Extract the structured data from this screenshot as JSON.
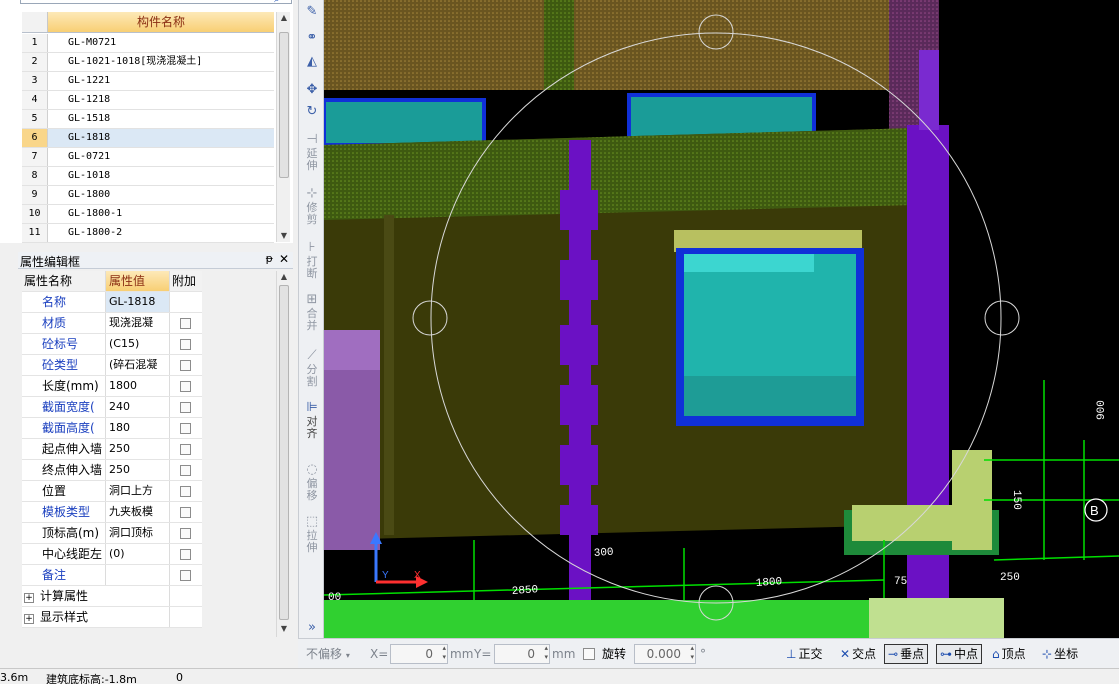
{
  "component_list": {
    "header": "构件名称",
    "rows": [
      {
        "num": "1",
        "name": "GL-M0721"
      },
      {
        "num": "2",
        "name": "GL-1021-1018[现浇混凝土]"
      },
      {
        "num": "3",
        "name": "GL-1221"
      },
      {
        "num": "4",
        "name": "GL-1218"
      },
      {
        "num": "5",
        "name": "GL-1518"
      },
      {
        "num": "6",
        "name": "GL-1818"
      },
      {
        "num": "7",
        "name": "GL-0721"
      },
      {
        "num": "8",
        "name": "GL-1018"
      },
      {
        "num": "9",
        "name": "GL-1800"
      },
      {
        "num": "10",
        "name": "GL-1800-1"
      },
      {
        "num": "11",
        "name": "GL-1800-2"
      }
    ],
    "selected": "6"
  },
  "property_panel": {
    "title": "属性编辑框",
    "pin_glyph": "ᵽ",
    "close_glyph": "✕",
    "headers": {
      "name": "属性名称",
      "value": "属性值",
      "extra": "附加"
    },
    "rows": [
      {
        "name": "名称",
        "value": "GL-1818",
        "blue": true,
        "checkbox": false
      },
      {
        "name": "材质",
        "value": "现浇混凝",
        "blue": true,
        "checkbox": true
      },
      {
        "name": "砼标号",
        "value": "(C15)",
        "blue": true,
        "checkbox": true
      },
      {
        "name": "砼类型",
        "value": "(碎石混凝",
        "blue": true,
        "checkbox": true
      },
      {
        "name": "长度(mm)",
        "value": "1800",
        "blue": false,
        "checkbox": true
      },
      {
        "name": "截面宽度(",
        "value": "240",
        "blue": true,
        "checkbox": true
      },
      {
        "name": "截面高度(",
        "value": "180",
        "blue": true,
        "checkbox": true
      },
      {
        "name": "起点伸入墙",
        "value": "250",
        "blue": false,
        "checkbox": true
      },
      {
        "name": "终点伸入墙",
        "value": "250",
        "blue": false,
        "checkbox": true
      },
      {
        "name": "位置",
        "value": "洞口上方",
        "blue": false,
        "checkbox": true
      },
      {
        "name": "模板类型",
        "value": "九夹板模",
        "blue": true,
        "checkbox": true
      },
      {
        "name": "顶标高(m)",
        "value": "洞口顶标",
        "blue": false,
        "checkbox": true
      },
      {
        "name": "中心线距左",
        "value": "(0)",
        "blue": false,
        "checkbox": true
      },
      {
        "name": "备注",
        "value": "",
        "blue": true,
        "checkbox": true
      }
    ],
    "groups": [
      {
        "name": "计算属性"
      },
      {
        "name": "显示样式"
      }
    ]
  },
  "vertical_toolbar": [
    {
      "id": "brush",
      "icon": "✎",
      "label": ""
    },
    {
      "id": "copy",
      "icon": "⚭",
      "label": ""
    },
    {
      "id": "mirror",
      "icon": "◭",
      "label": ""
    },
    {
      "id": "move",
      "icon": "✥",
      "label": ""
    },
    {
      "id": "rotate",
      "icon": "↻",
      "label": ""
    },
    {
      "id": "extend",
      "icon": "⊣",
      "label": "延伸"
    },
    {
      "id": "trim",
      "icon": "⊹",
      "label": "修剪"
    },
    {
      "id": "break",
      "icon": "⊦",
      "label": "打断"
    },
    {
      "id": "merge",
      "icon": "⊞",
      "label": "合并"
    },
    {
      "id": "split",
      "icon": "⟋",
      "label": "分割"
    },
    {
      "id": "align",
      "icon": "⊫",
      "label": "对齐"
    },
    {
      "id": "offset",
      "icon": "◌",
      "label": "偏移"
    },
    {
      "id": "stretch",
      "icon": "⬚",
      "label": "拉伸"
    },
    {
      "id": "more",
      "icon": "»",
      "label": ""
    }
  ],
  "bottom_toolbar": {
    "offset_mode": "不偏移",
    "x_label": "X=",
    "x_value": "0",
    "x_unit": "mm",
    "y_label": "Y=",
    "y_value": "0",
    "y_unit": "mm",
    "rotate_label": "旋转",
    "rotate_value": "0.000",
    "rotate_unit": "°",
    "snaps": [
      {
        "label": "正交",
        "icon": "⊥",
        "active": false
      },
      {
        "label": "交点",
        "icon": "✕",
        "active": false
      },
      {
        "label": "垂点",
        "icon": "⊸",
        "active": true
      },
      {
        "label": "中点",
        "icon": "⊶",
        "active": true
      },
      {
        "label": "顶点",
        "icon": "⌂",
        "active": false
      },
      {
        "label": "坐标",
        "icon": "⊹",
        "active": false
      }
    ]
  },
  "canvas_labels": {
    "dim_300": "300",
    "dim_2850": "2850",
    "dim_1800": "1800",
    "dim_250": "250",
    "dim_75": "75",
    "dim_00": "00",
    "dim_900": "900",
    "dim_150": "150",
    "axis_b": "B",
    "axis_y": "Y",
    "axis_x": "X"
  },
  "status_bar": {
    "left": "3.6m",
    "base_elev": "建筑底标高:-1.8m",
    "value": "0"
  },
  "colors": {
    "wall": "#3a3a0a",
    "beam_purple": "#6b11c4",
    "window_cyan": "#1fb8b0",
    "window_frame": "#1030d8",
    "grid_green": "#00e000"
  }
}
